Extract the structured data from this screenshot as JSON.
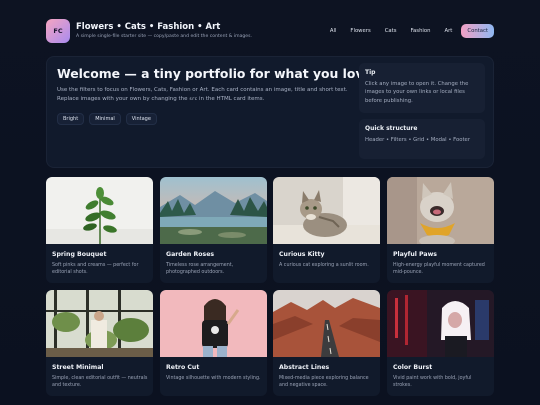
{
  "header": {
    "logo_text": "FC",
    "title": "Flowers • Cats • Fashion • Art",
    "subtitle": "A simple single-file starter site — copy/paste and edit the content & images.",
    "nav": [
      "All",
      "Flowers",
      "Cats",
      "Fashion",
      "Art",
      "Contact"
    ]
  },
  "hero": {
    "title": "Welcome — a tiny portfolio for what you love",
    "desc_before": "Use the filters to focus on Flowers, Cats, Fashion or Art. Each card contains an image, title and short text. Replace images with your own by changing the ",
    "desc_code": "src",
    "desc_after": " in the HTML card items.",
    "chips": [
      "Bright",
      "Minimal",
      "Vintage"
    ],
    "tip": {
      "title": "Tip",
      "text": "Click any image to open it. Change the images to your own links or local files before publishing."
    },
    "quick_structure": {
      "title": "Quick structure",
      "text": "Header • Filters • Grid • Modal • Footer"
    }
  },
  "cards": [
    {
      "title": "Spring Bouquet",
      "desc": "Soft pinks and creams — perfect for editorial shots."
    },
    {
      "title": "Garden Roses",
      "desc": "Timeless rose arrangement, photographed outdoors."
    },
    {
      "title": "Curious Kitty",
      "desc": "A curious cat exploring a sunlit room."
    },
    {
      "title": "Playful Paws",
      "desc": "High-energy playful moment captured mid-pounce."
    },
    {
      "title": "Street Minimal",
      "desc": "Simple, clean editorial outfit — neutrals and texture."
    },
    {
      "title": "Retro Cut",
      "desc": "Vintage silhouette with modern styling."
    },
    {
      "title": "Abstract Lines",
      "desc": "Mixed-media piece exploring balance and negative space."
    },
    {
      "title": "Color Burst",
      "desc": "Vivid paint work with bold, joyful strokes."
    }
  ]
}
